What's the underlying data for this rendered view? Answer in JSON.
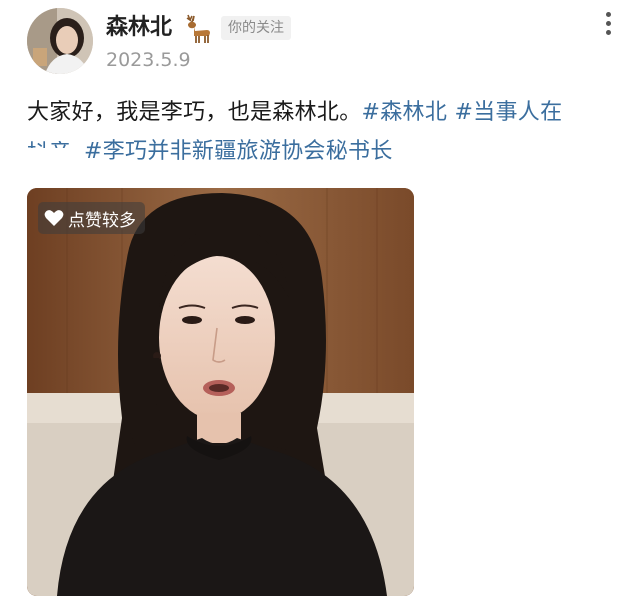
{
  "header": {
    "username": "森林北",
    "follow_badge": "你的关注",
    "date": "2023.5.9"
  },
  "icons": {
    "avatar": "avatar",
    "deer": "deer-icon",
    "more": "more-icon",
    "heart": "heart-icon"
  },
  "post": {
    "line1_text": "大家好，我是李巧，也是森林北。",
    "hashtag1": "#森林北",
    "hashtag2": "#当事人在",
    "line2_cut": "抖音",
    "hashtag3": "#李巧并非新疆旅游协会秘书长"
  },
  "video": {
    "badge": "点赞较多"
  },
  "colors": {
    "hashtag": "#3b6e9e",
    "text": "#1a1a1a",
    "muted": "#9a9a9a"
  }
}
